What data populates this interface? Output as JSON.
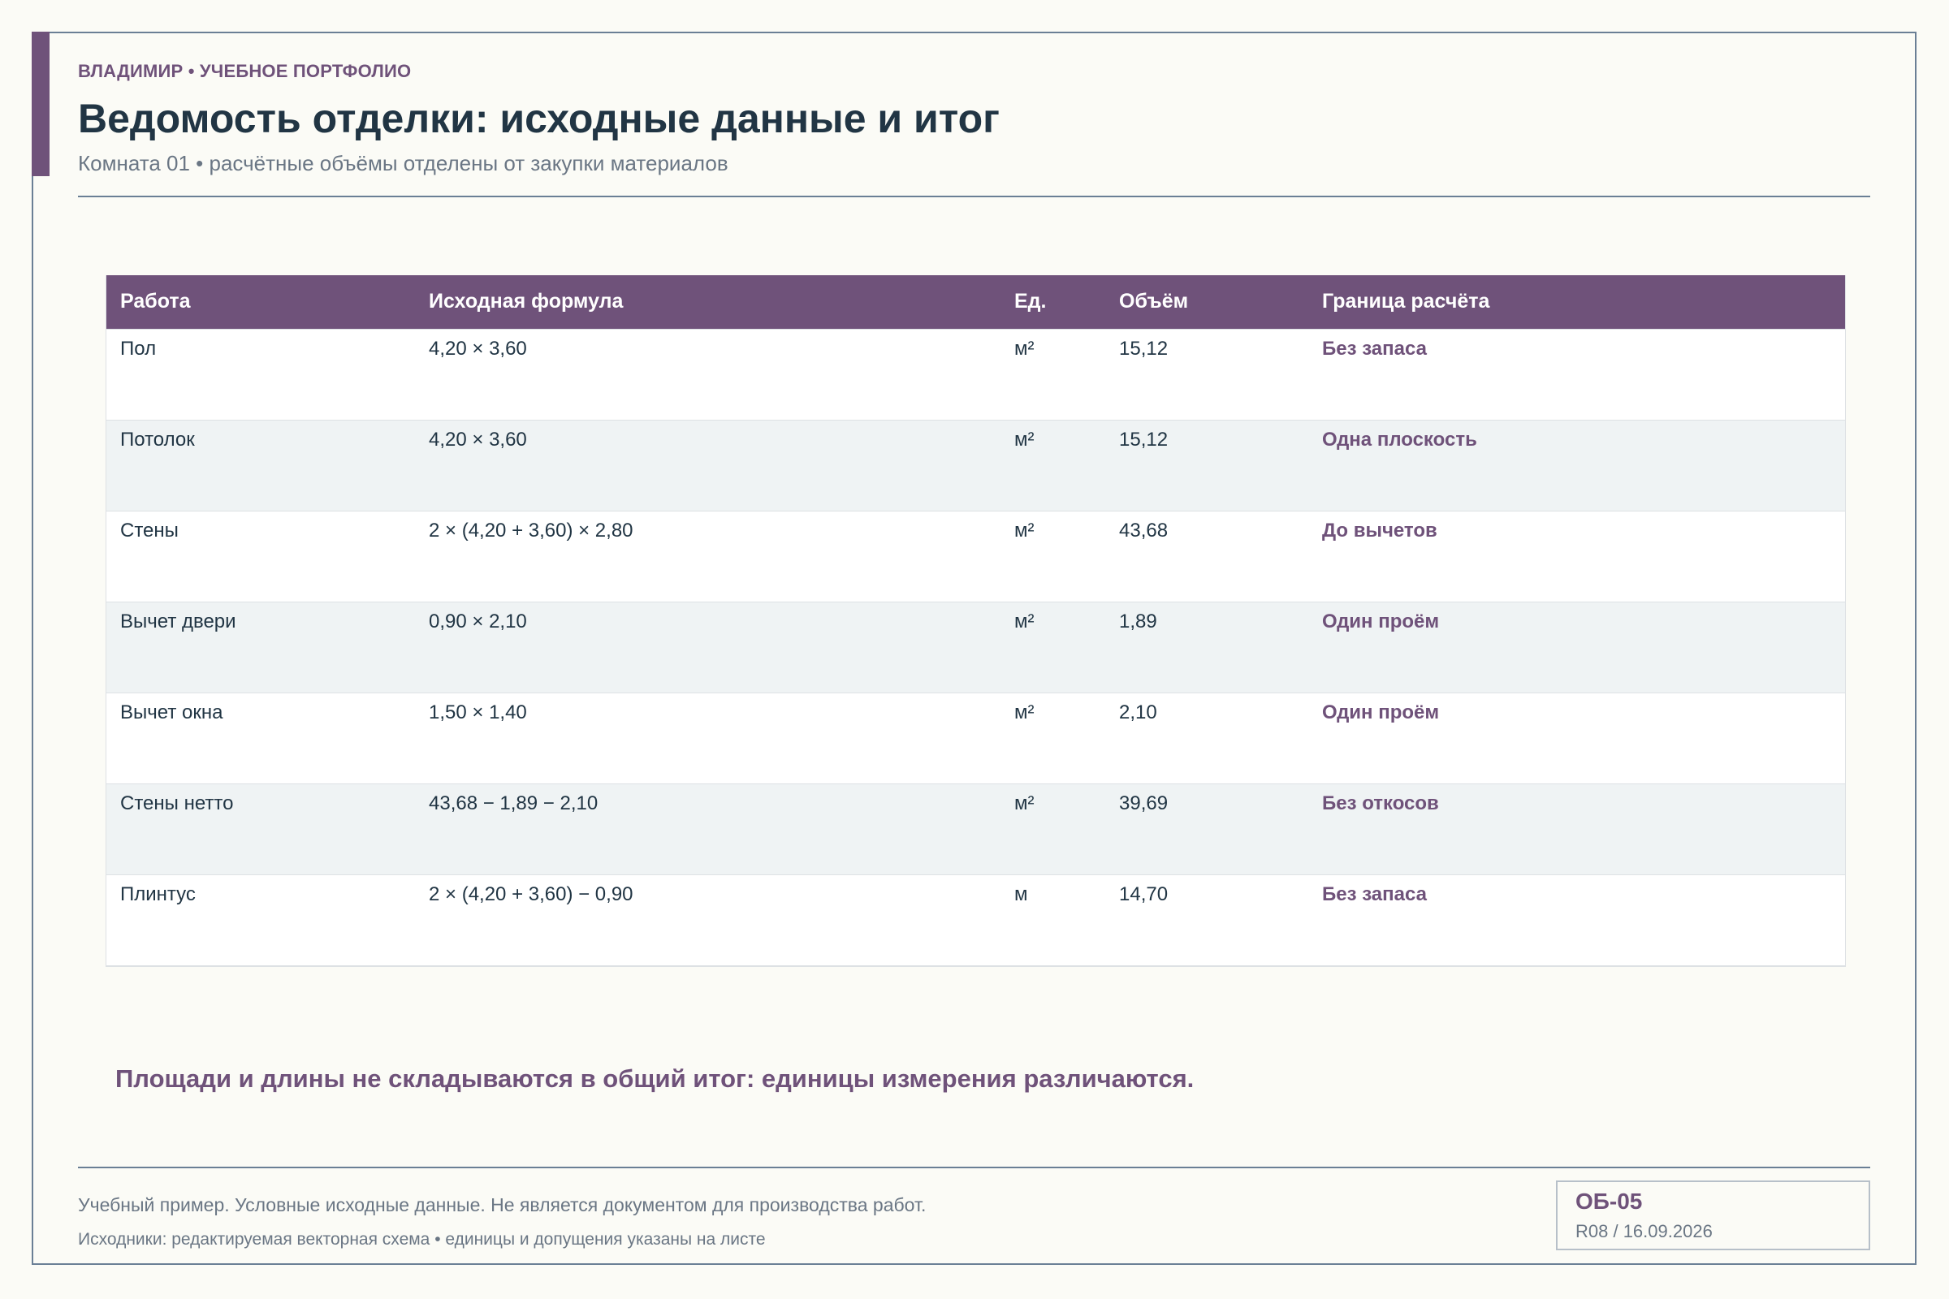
{
  "header": {
    "kicker": "ВЛАДИМИР • УЧЕБНОЕ ПОРТФОЛИО",
    "title": "Ведомость отделки: исходные данные и итог",
    "subtitle": "Комната 01 • расчётные объёмы отделены от закупки материалов"
  },
  "table": {
    "columns": [
      "Работа",
      "Исходная формула",
      "Ед.",
      "Объём",
      "Граница расчёта"
    ],
    "rows": [
      {
        "work": "Пол",
        "formula": "4,20 × 3,60",
        "unit": "м²",
        "volume": "15,12",
        "boundary": "Без запаса"
      },
      {
        "work": "Потолок",
        "formula": "4,20 × 3,60",
        "unit": "м²",
        "volume": "15,12",
        "boundary": "Одна плоскость"
      },
      {
        "work": "Стены",
        "formula": "2 × (4,20 + 3,60) × 2,80",
        "unit": "м²",
        "volume": "43,68",
        "boundary": "До вычетов"
      },
      {
        "work": "Вычет двери",
        "formula": "0,90 × 2,10",
        "unit": "м²",
        "volume": "1,89",
        "boundary": "Один проём"
      },
      {
        "work": "Вычет окна",
        "formula": "1,50 × 1,40",
        "unit": "м²",
        "volume": "2,10",
        "boundary": "Один проём"
      },
      {
        "work": "Стены нетто",
        "formula": "43,68 − 1,89 − 2,10",
        "unit": "м²",
        "volume": "39,69",
        "boundary": "Без откосов"
      },
      {
        "work": "Плинтус",
        "formula": "2 × (4,20 + 3,60) − 0,90",
        "unit": "м",
        "volume": "14,70",
        "boundary": "Без запаса"
      }
    ]
  },
  "callout": "Площади и длины не складываются в общий итог: единицы измерения различаются.",
  "footer": {
    "disclaimer": "Учебный пример. Условные исходные данные. Не является документом для производства работ.",
    "sources": "Исходники: редактируемая векторная схема • единицы и допущения указаны на листе",
    "sheet_code": "ОБ-05",
    "revision": "R08 / 16.09.2026"
  },
  "colors": {
    "accent": "#6f527a",
    "ink": "#213544",
    "muted": "#6a7684",
    "frame": "#6a7f95",
    "paper": "#fbfbf6",
    "row_alt": "#eff3f4"
  }
}
